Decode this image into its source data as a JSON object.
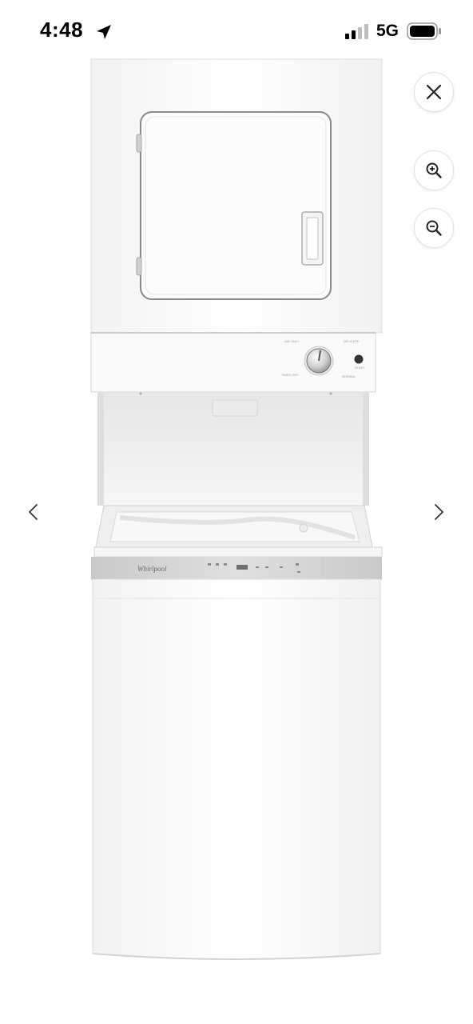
{
  "status_bar": {
    "time": "4:48",
    "network": "5G",
    "icons": [
      "location-arrow-icon",
      "signal-bars-icon",
      "battery-icon"
    ]
  },
  "controls": {
    "close_icon": "close-icon",
    "zoom_in_icon": "zoom-in-icon",
    "zoom_out_icon": "zoom-out-icon",
    "prev_icon": "chevron-left-icon",
    "next_icon": "chevron-right-icon"
  },
  "product": {
    "brand_mark": "Whirlpool"
  },
  "colors": {
    "background": "#ffffff",
    "appliance_white": "#fbfbfb",
    "trim_gray": "#cfcfcf",
    "icon_dark": "#222222"
  }
}
